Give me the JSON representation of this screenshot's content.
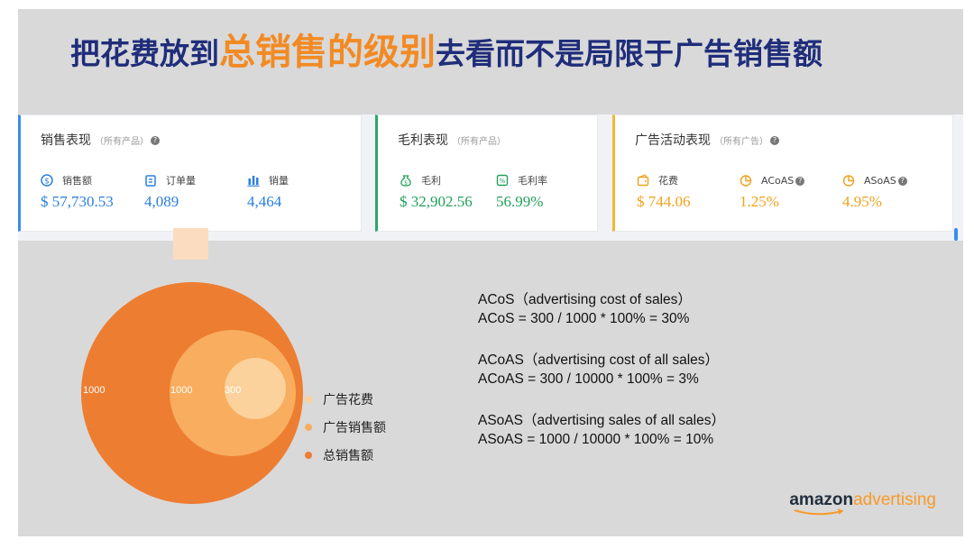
{
  "headline": {
    "part1": "把花费放到",
    "emph1": "总销售",
    "part2": "的",
    "emph2": "级别",
    "part3": "去看而不是局限于广告销售额"
  },
  "cards": {
    "sales": {
      "title": "销售表现",
      "subtitle": "（所有产品）",
      "metrics": [
        {
          "label": "销售额",
          "value": "$ 57,730.53",
          "icon": "dollar-circle-icon"
        },
        {
          "label": "订单量",
          "value": "4,089",
          "icon": "clipboard-icon"
        },
        {
          "label": "销量",
          "value": "4,464",
          "icon": "bar-chart-icon"
        }
      ]
    },
    "profit": {
      "title": "毛利表现",
      "subtitle": "（所有产品）",
      "metrics": [
        {
          "label": "毛利",
          "value": "$ 32,902.56",
          "icon": "money-bag-icon"
        },
        {
          "label": "毛利率",
          "value": "56.99%",
          "icon": "percent-icon"
        }
      ]
    },
    "ads": {
      "title": "广告活动表现",
      "subtitle": "（所有广告）",
      "metrics": [
        {
          "label": "花费",
          "value": "$ 744.06",
          "icon": "wallet-icon"
        },
        {
          "label": "ACoAS",
          "value": "1.25%",
          "icon": "pie-icon"
        },
        {
          "label": "ASoAS",
          "value": "4.95%",
          "icon": "pie-icon"
        }
      ]
    }
  },
  "venn": {
    "labels": [
      "1000",
      "1000",
      "300"
    ]
  },
  "legend": [
    {
      "label": "广告花费",
      "color": "#fbd19c"
    },
    {
      "label": "广告销售额",
      "color": "#f8ad5f"
    },
    {
      "label": "总销售额",
      "color": "#ed7d31"
    }
  ],
  "formulas": [
    {
      "title": "ACoS（advertising cost of sales）",
      "expr": "ACoS = 300 / 1000 * 100% = 30%"
    },
    {
      "title": "ACoAS（advertising cost of all sales）",
      "expr": "ACoAS = 300 / 10000 * 100% = 3%"
    },
    {
      "title": "ASoAS（advertising sales of all sales）",
      "expr": "ASoAS = 1000 / 10000 * 100% = 10%"
    }
  ],
  "brand": {
    "part1": "amazon",
    "part2": "advertising"
  },
  "colors": {
    "headline": "#1f2d7a",
    "emphasis": "#f28a24",
    "sales_accent": "#2a7ee0",
    "profit_accent": "#22a05a",
    "ads_accent": "#f0a11d"
  }
}
